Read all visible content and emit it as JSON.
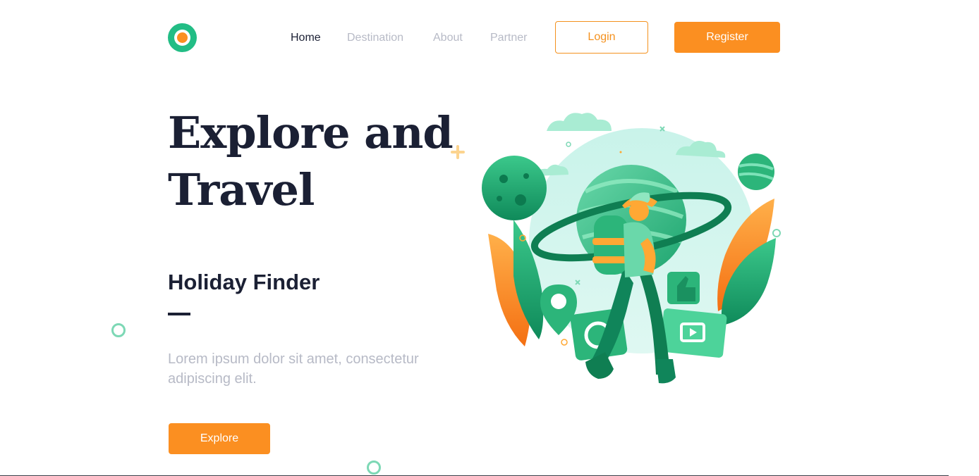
{
  "header": {
    "nav": [
      {
        "label": "Home",
        "active": true
      },
      {
        "label": "Destination",
        "active": false
      },
      {
        "label": "About",
        "active": false
      },
      {
        "label": "Partner",
        "active": false
      }
    ],
    "login_label": "Login",
    "register_label": "Register"
  },
  "hero": {
    "title_line1": "Explore and",
    "title_line2": "Travel",
    "subtitle": "Holiday Finder",
    "description": "Lorem ipsum dolor sit amet, consectetur adipiscing elit.",
    "cta_label": "Explore"
  },
  "illustration": {
    "icon": "traveler-illustration"
  },
  "colors": {
    "brand_orange": "#fb8f21",
    "brand_green": "#22bd85",
    "heading": "#1b2034",
    "muted": "#b7bac6"
  }
}
